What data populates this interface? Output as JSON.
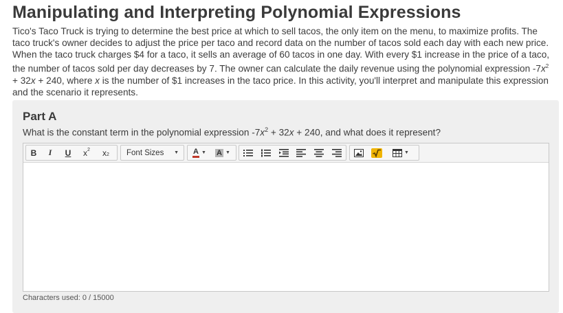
{
  "page": {
    "title": "Manipulating and Interpreting Polynomial Expressions",
    "intro_part1": "Tico's Taco Truck is trying to determine the best price at which to sell tacos, the only item on the menu, to maximize profits. The taco truck's owner decides to adjust the price per taco and record data on the number of tacos sold each day with each new price. When the taco truck charges $4 for a taco, it sells an average of 60 tacos in one day. With every $1 increase in the price of a taco, the number of tacos sold per day decreases by 7. The owner can calculate the daily revenue using the polynomial expression -7",
    "intro_x1": "x",
    "intro_sup": "2",
    "intro_part2": " + 32",
    "intro_x2": "x",
    "intro_part3": " + 240, where ",
    "intro_x3": "x",
    "intro_part4": " is the number of $1 increases in the taco price. In this activity, you'll interpret and manipulate this expression and the scenario it represents."
  },
  "part_a": {
    "title": "Part A",
    "q_part1": "What is the constant term in the polynomial expression -7",
    "q_x1": "x",
    "q_sup": "2",
    "q_part2": " + 32",
    "q_x2": "x",
    "q_part3": " + 240, and what does it represent?"
  },
  "editor": {
    "toolbar": {
      "bold": "B",
      "italic": "I",
      "underline": "U",
      "superscript": "x",
      "subscript": "x",
      "font_sizes": "Font Sizes",
      "text_color": "A",
      "bg_color": "A"
    },
    "content": "",
    "char_count": "Characters used: 0 / 15000"
  },
  "colors": {
    "panel_bg": "#efefef",
    "toolbar_bg": "#f4f4f4",
    "text_color_swatch": "#c0392b",
    "bg_color_swatch": "#b5b5b5",
    "math_icon": "#f0b400"
  }
}
